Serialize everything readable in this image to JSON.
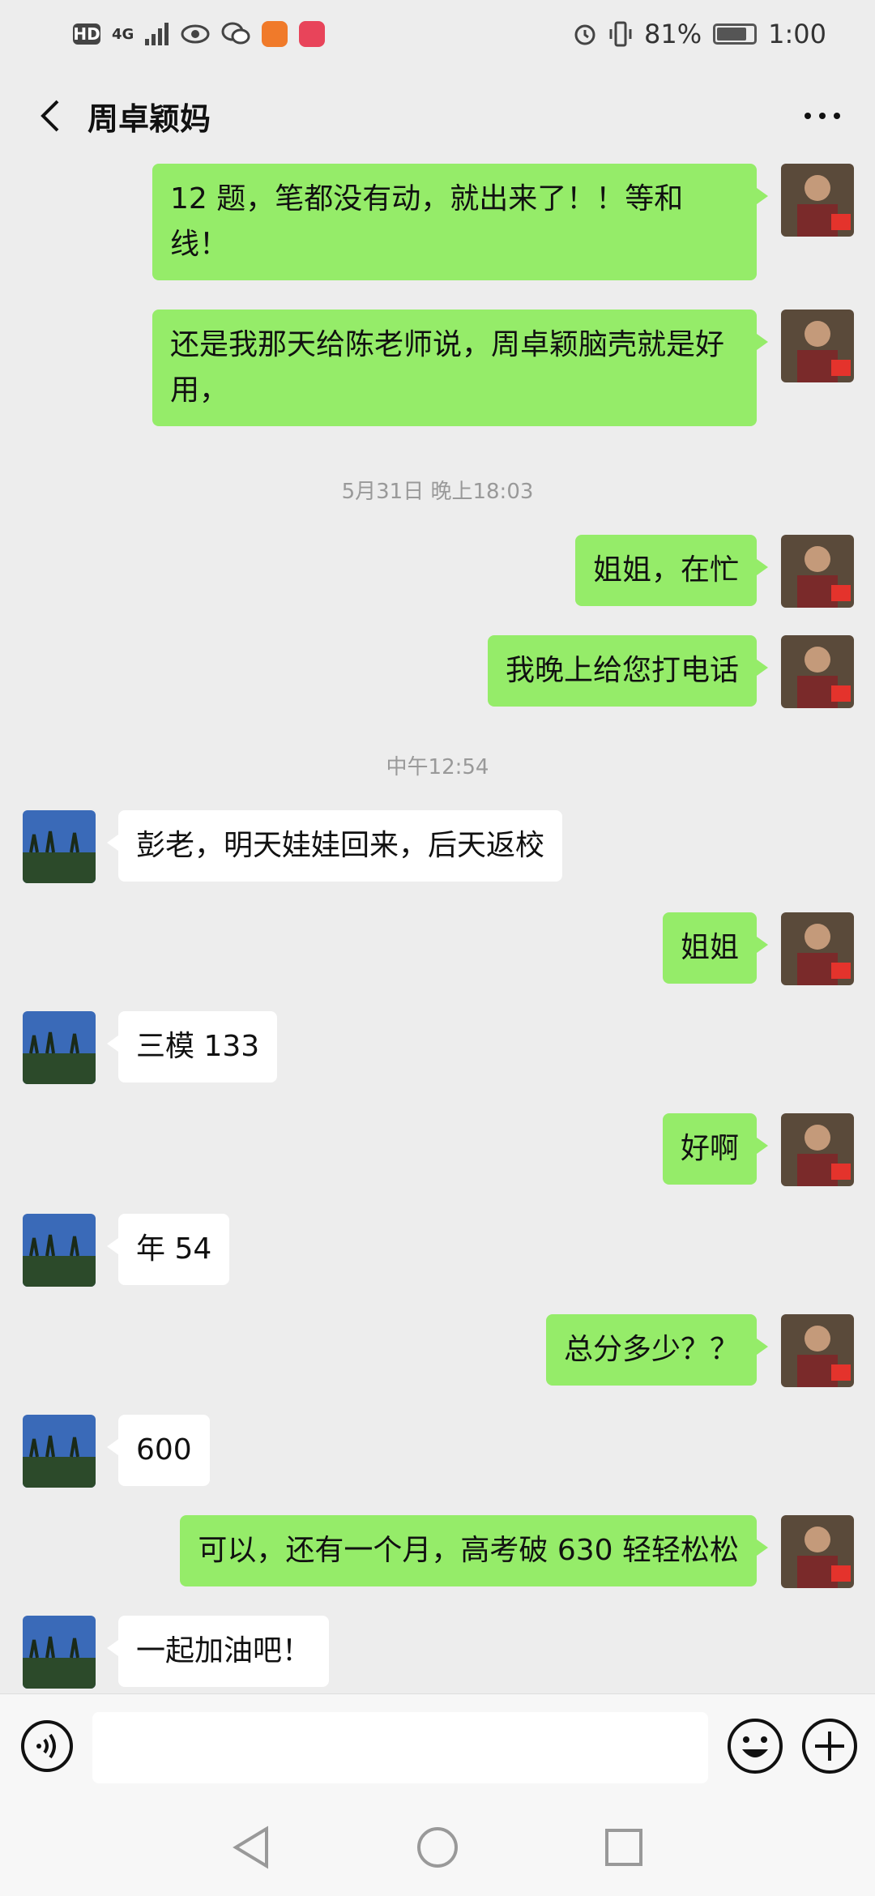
{
  "status_bar": {
    "hd": "HD",
    "network": "4G",
    "battery": "81%",
    "time": "1:00"
  },
  "header": {
    "title": "周卓颖妈"
  },
  "messages": [
    {
      "from": "me",
      "text": "12 题，笔都没有动，就出来了！！等和线！"
    },
    {
      "from": "me",
      "text": "还是我那天给陈老师说，周卓颖脑壳就是好用，"
    },
    {
      "timestamp": "5月31日 晚上18:03"
    },
    {
      "from": "me",
      "text": "姐姐，在忙"
    },
    {
      "from": "me",
      "text": "我晚上给您打电话"
    },
    {
      "timestamp": "中午12:54"
    },
    {
      "from": "them",
      "text": "彭老，明天娃娃回来，后天返校"
    },
    {
      "from": "me",
      "text": "姐姐"
    },
    {
      "from": "them",
      "text": "三模 133"
    },
    {
      "from": "me",
      "text": "好啊"
    },
    {
      "from": "them",
      "text": "年 54"
    },
    {
      "from": "me",
      "text": "总分多少？？"
    },
    {
      "from": "them",
      "text": "600"
    },
    {
      "from": "me",
      "text": "可以，还有一个月，高考破 630 轻轻松松"
    },
    {
      "from": "them",
      "text": "一起加油吧！"
    }
  ],
  "input": {
    "value": "",
    "placeholder": ""
  },
  "colors": {
    "background": "#ededed",
    "my_bubble": "#95ec69",
    "their_bubble": "#ffffff"
  },
  "icons": {
    "back": "chevron-left-icon",
    "more": "more-dots-icon",
    "voice": "voice-icon",
    "emoji": "emoji-icon",
    "plus": "plus-icon",
    "nav_back": "nav-back-icon",
    "nav_home": "nav-home-icon",
    "nav_recent": "nav-recent-icon"
  }
}
